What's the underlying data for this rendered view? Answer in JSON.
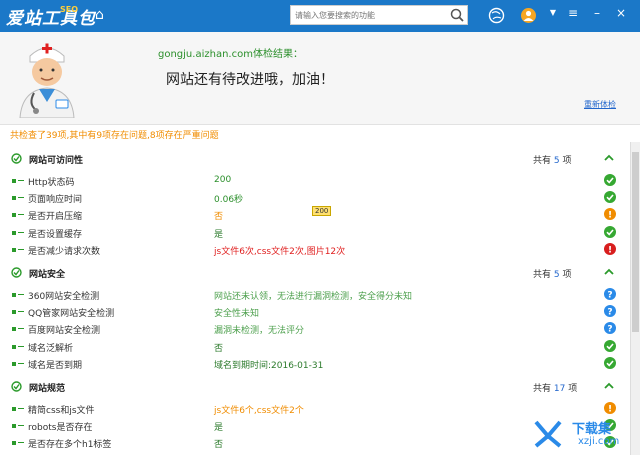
{
  "app": {
    "logo": "爱站工具包",
    "logo_sub": "SEO"
  },
  "search": {
    "placeholder": "请输入您要搜索的功能"
  },
  "header": {
    "site_title": "gongju.aizhan.com",
    "site_title_suffix": "体检结果：",
    "message": "网站还有待改进哦，加油！",
    "recheck": "重新体检"
  },
  "summary": "共检查了39项,其中有9项存在问题,8项存在严重问题",
  "tooltip": "200",
  "sections": [
    {
      "title": "网站可访问性",
      "count_prefix": "共有",
      "count": "5",
      "count_suffix": "项",
      "rows": [
        {
          "name": "Http状态码",
          "value": "200",
          "color": "green",
          "status": "ok"
        },
        {
          "name": "页面响应时间",
          "value": "0.06秒",
          "color": "green",
          "status": "ok"
        },
        {
          "name": "是否开启压缩",
          "value": "否",
          "color": "orange",
          "status": "warn"
        },
        {
          "name": "是否设置缓存",
          "value": "是",
          "color": "dark",
          "status": "ok"
        },
        {
          "name": "是否减少请求次数",
          "value": "js文件6次,css文件2次,图片12次",
          "color": "red",
          "status": "error"
        }
      ]
    },
    {
      "title": "网站安全",
      "count_prefix": "共有",
      "count": "5",
      "count_suffix": "项",
      "rows": [
        {
          "name": "360网站安全检测",
          "value": "网站还未认领，无法进行漏洞检测，安全得分未知",
          "color": "muted",
          "status": "info"
        },
        {
          "name": "QQ管家网站安全检测",
          "value": "安全性未知",
          "color": "muted",
          "status": "info"
        },
        {
          "name": "百度网站安全检测",
          "value": "漏洞未检测，无法评分",
          "color": "muted",
          "status": "info"
        },
        {
          "name": "域名泛解析",
          "value": "否",
          "color": "dark",
          "status": "ok"
        },
        {
          "name": "域名是否到期",
          "value": "域名到期时间:2016-01-31",
          "color": "dark",
          "status": "ok"
        }
      ]
    },
    {
      "title": "网站规范",
      "count_prefix": "共有",
      "count": "17",
      "count_suffix": "项",
      "rows": [
        {
          "name": "精简css和js文件",
          "value": "js文件6个,css文件2个",
          "color": "orange",
          "status": "warn"
        },
        {
          "name": "robots是否存在",
          "value": "是",
          "color": "dark",
          "status": "ok"
        },
        {
          "name": "是否存在多个h1标签",
          "value": "否",
          "color": "dark",
          "status": "ok"
        }
      ]
    }
  ],
  "watermark": {
    "line1": "下载集",
    "line2": "xzji.com"
  },
  "colors": {
    "titlebar": "#1b78c8",
    "ok": "#36a832",
    "warn": "#f08c00",
    "error": "#d81e1e",
    "info": "#2a8ae8"
  }
}
